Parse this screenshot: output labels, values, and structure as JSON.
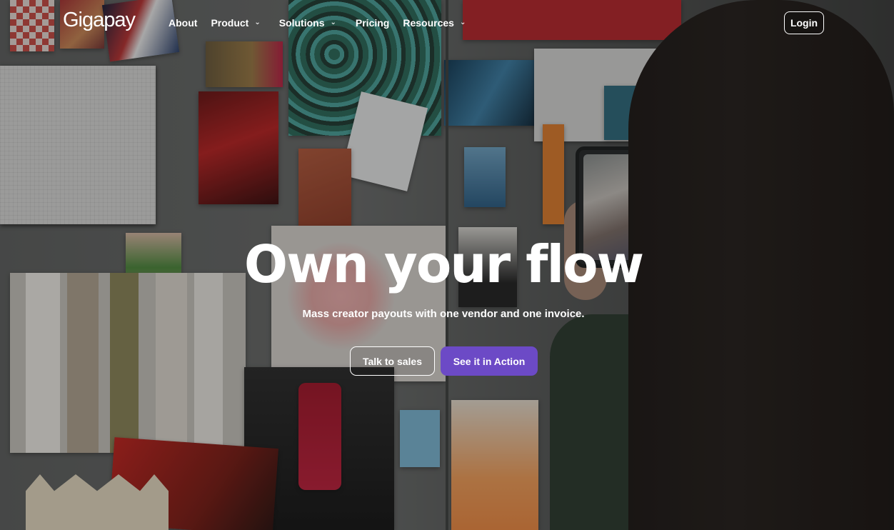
{
  "brand": {
    "logo_text": "Gigapay"
  },
  "nav": {
    "items": [
      {
        "label": "About",
        "has_dropdown": false
      },
      {
        "label": "Product",
        "has_dropdown": true
      },
      {
        "label": "Solutions",
        "has_dropdown": true
      },
      {
        "label": "Pricing",
        "has_dropdown": false
      },
      {
        "label": "Resources",
        "has_dropdown": true
      }
    ],
    "dropdown_icon": "chevron-down-icon",
    "login_label": "Login"
  },
  "hero": {
    "title": "Own your flow",
    "subtitle": "Mass creator payouts with one vendor and one invoice.",
    "secondary_cta": "Talk to sales",
    "primary_cta": "See it in Action"
  },
  "colors": {
    "primary_button": "#6c4ac6",
    "text": "#ffffff"
  }
}
